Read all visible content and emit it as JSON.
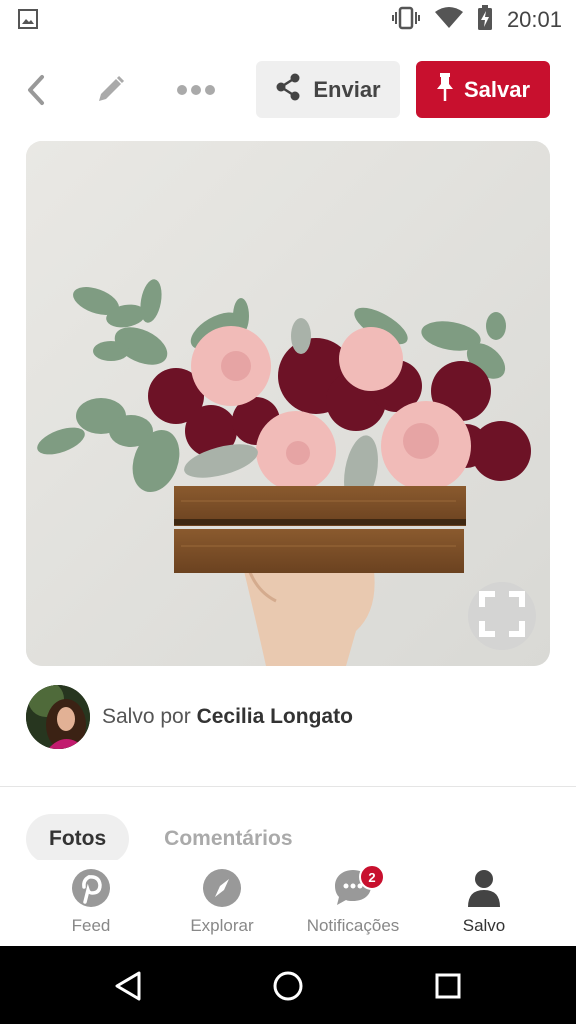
{
  "status_bar": {
    "time": "20:01",
    "icons": [
      "image-icon",
      "vibrate-icon",
      "wifi-icon",
      "battery-charging-icon"
    ]
  },
  "action_bar": {
    "back_icon": "chevron-left-icon",
    "edit_icon": "pencil-icon",
    "more_icon": "more-horizontal-icon",
    "send_label": "Enviar",
    "send_icon": "share-icon",
    "save_label": "Salvar",
    "save_icon": "pin-icon",
    "brand_color": "#c8102e"
  },
  "pin": {
    "image_alt": "Arranjo de flores em caixa de madeira",
    "fullscreen_icon": "fullscreen-icon"
  },
  "saved_by": {
    "prefix": "Salvo por",
    "name": "Cecilia Longato"
  },
  "tabs": [
    {
      "label": "Fotos",
      "active": true
    },
    {
      "label": "Comentários",
      "active": false
    }
  ],
  "bottom_nav": [
    {
      "label": "Feed",
      "icon": "pinterest-icon",
      "active": false
    },
    {
      "label": "Explorar",
      "icon": "compass-icon",
      "active": false
    },
    {
      "label": "Notificações",
      "icon": "chat-bubble-icon",
      "badge": "2",
      "active": false
    },
    {
      "label": "Salvo",
      "icon": "person-icon",
      "active": true
    }
  ],
  "system_nav": [
    "back-triangle-icon",
    "home-circle-icon",
    "recents-square-icon"
  ]
}
